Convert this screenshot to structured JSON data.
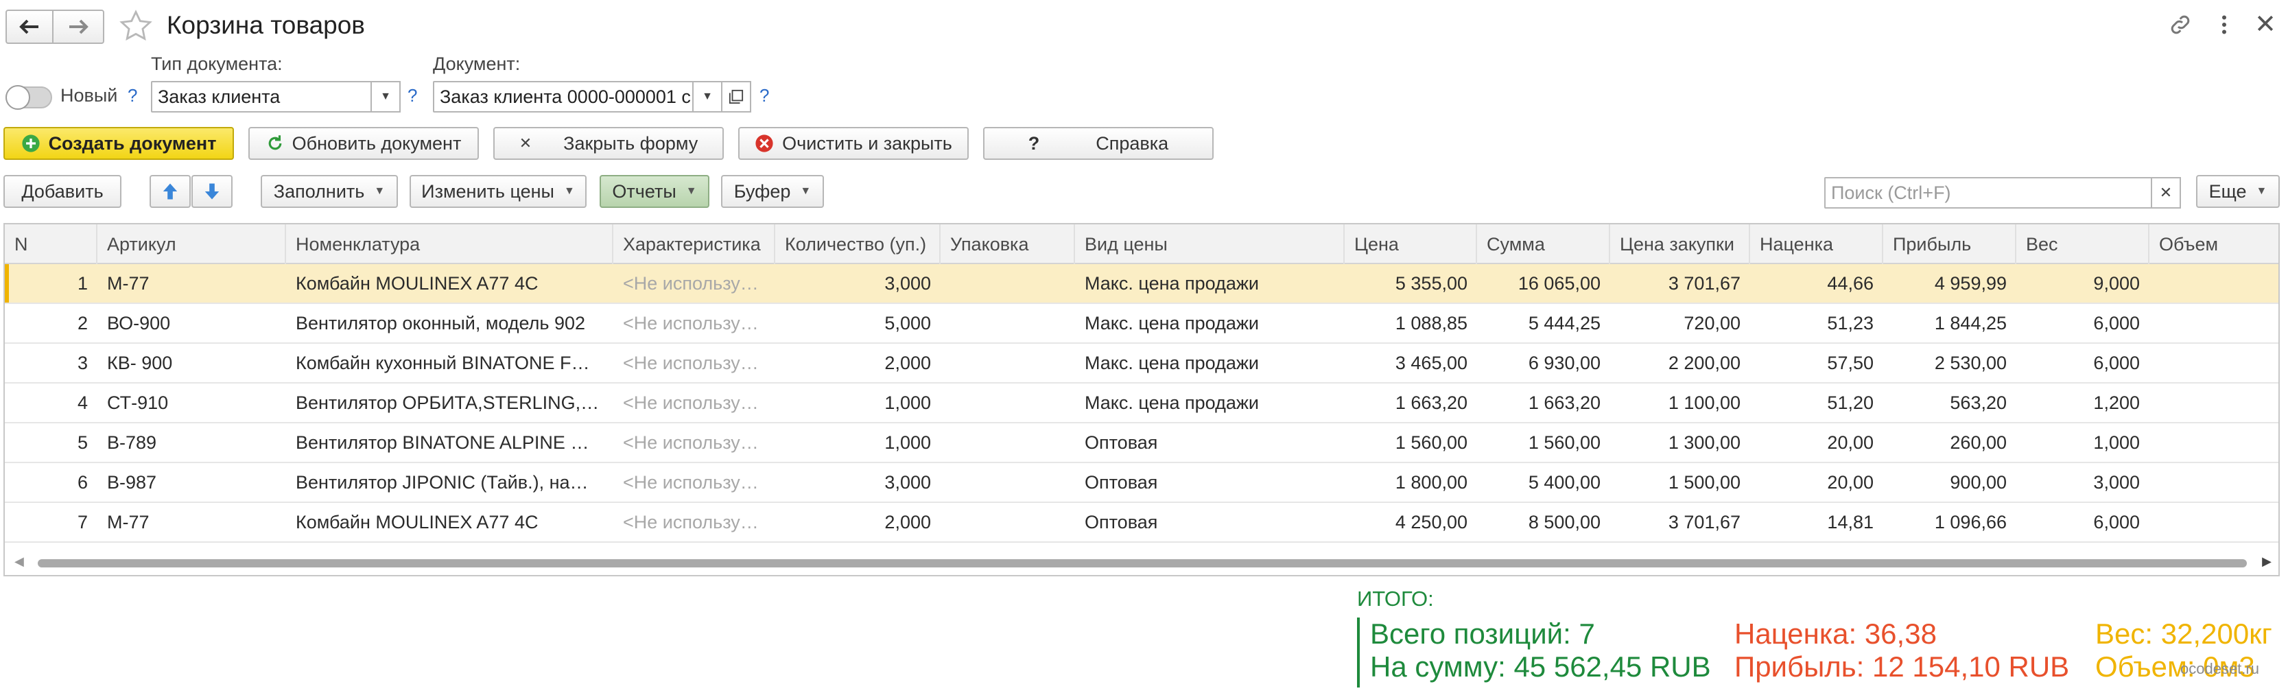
{
  "window": {
    "title": "Корзина товаров"
  },
  "form": {
    "new_label": "Новый",
    "help_mark": "?",
    "doc_type_label": "Тип документа:",
    "doc_type_value": "Заказ клиента",
    "doc_label": "Документ:",
    "doc_value": "Заказ клиента 0000-000001 с"
  },
  "actions": {
    "create": "Создать документ",
    "refresh": "Обновить документ",
    "close": "Закрыть форму",
    "clear_close": "Очистить и закрыть",
    "help": "Справка"
  },
  "toolbar": {
    "add": "Добавить",
    "fill": "Заполнить",
    "change_prices": "Изменить цены",
    "reports": "Отчеты",
    "buffer": "Буфер",
    "search_placeholder": "Поиск (Ctrl+F)",
    "more": "Еще"
  },
  "table": {
    "columns": [
      "N",
      "Артикул",
      "Номенклатура",
      "Характеристика",
      "Количество (уп.)",
      "Упаковка",
      "Вид цены",
      "Цена",
      "Сумма",
      "Цена закупки",
      "Наценка",
      "Прибыль",
      "Вес",
      "Объем"
    ],
    "rows": [
      [
        "1",
        "М-77",
        "Комбайн MOULINEX  A77 4C",
        "<Не использу…",
        "3,000",
        "",
        "Макс. цена продажи",
        "5 355,00",
        "16 065,00",
        "3 701,67",
        "44,66",
        "4 959,99",
        "9,000",
        ""
      ],
      [
        "2",
        "ВО-900",
        "Вентилятор оконный, модель 902",
        "<Не использу…",
        "5,000",
        "",
        "Макс. цена продажи",
        "1 088,85",
        "5 444,25",
        "720,00",
        "51,23",
        "1 844,25",
        "6,000",
        ""
      ],
      [
        "3",
        "КВ- 900",
        "Комбайн кухонный BINATONE F…",
        "<Не использу…",
        "2,000",
        "",
        "Макс. цена продажи",
        "3 465,00",
        "6 930,00",
        "2 200,00",
        "57,50",
        "2 530,00",
        "6,000",
        ""
      ],
      [
        "4",
        "СТ-910",
        "Вентилятор ОРБИТА,STERLING,…",
        "<Не использу…",
        "1,000",
        "",
        "Макс. цена продажи",
        "1 663,20",
        "1 663,20",
        "1 100,00",
        "51,20",
        "563,20",
        "1,200",
        ""
      ],
      [
        "5",
        "В-789",
        "Вентилятор BINATONE ALPINE …",
        "<Не использу…",
        "1,000",
        "",
        "Оптовая",
        "1 560,00",
        "1 560,00",
        "1 300,00",
        "20,00",
        "260,00",
        "1,000",
        ""
      ],
      [
        "6",
        "В-987",
        "Вентилятор JIPONIC (Тайв.), на…",
        "<Не использу…",
        "3,000",
        "",
        "Оптовая",
        "1 800,00",
        "5 400,00",
        "1 500,00",
        "20,00",
        "900,00",
        "3,000",
        ""
      ],
      [
        "7",
        "М-77",
        "Комбайн MOULINEX  A77 4C",
        "<Не использу…",
        "2,000",
        "",
        "Оптовая",
        "4 250,00",
        "8 500,00",
        "3 701,67",
        "14,81",
        "1 096,66",
        "6,000",
        ""
      ]
    ]
  },
  "totals": {
    "heading": "ИТОГО:",
    "positions": "Всего позиций: 7",
    "sum": "На сумму: 45 562,45 RUB",
    "markup": "Наценка: 36,38",
    "profit": "Прибыль: 12 154,10 RUB",
    "weight": "Вес: 32,200кг",
    "volume": "Объем: 0м3",
    "green": "#1e8a3c",
    "red": "#e8502c",
    "yellow": "#f0b400"
  },
  "watermark": "ocodeset.ru"
}
